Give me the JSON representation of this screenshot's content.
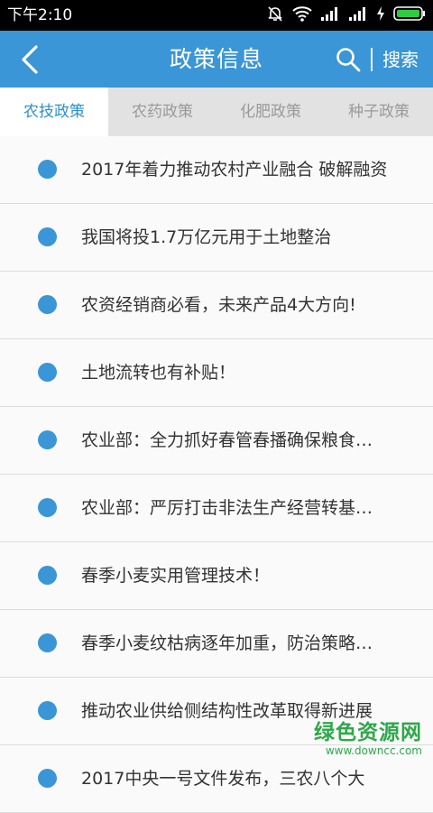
{
  "status": {
    "time": "下午2:10"
  },
  "header": {
    "title": "政策信息",
    "search_label": "搜索"
  },
  "tabs": [
    {
      "label": "农技政策",
      "active": true
    },
    {
      "label": "农药政策",
      "active": false
    },
    {
      "label": "化肥政策",
      "active": false
    },
    {
      "label": "种子政策",
      "active": false
    }
  ],
  "list": [
    "2017年着力推动农村产业融合 破解融资",
    "我国将投1.7万亿元用于土地整治",
    "农资经销商必看，未来产品4大方向!",
    "土地流转也有补贴！",
    "农业部：全力抓好春管春播确保粮食…",
    "农业部：严厉打击非法生产经营转基…",
    "春季小麦实用管理技术！",
    "春季小麦纹枯病逐年加重，防治策略…",
    "推动农业供给侧结构性改革取得新进展",
    "2017中央一号文件发布，三农八个大"
  ],
  "watermark": {
    "title": "绿色资源网",
    "url": "www.downcc.com"
  },
  "colors": {
    "accent": "#3a96d6",
    "tab_active_text": "#2f8fd2",
    "watermark": "#2ea84a"
  }
}
